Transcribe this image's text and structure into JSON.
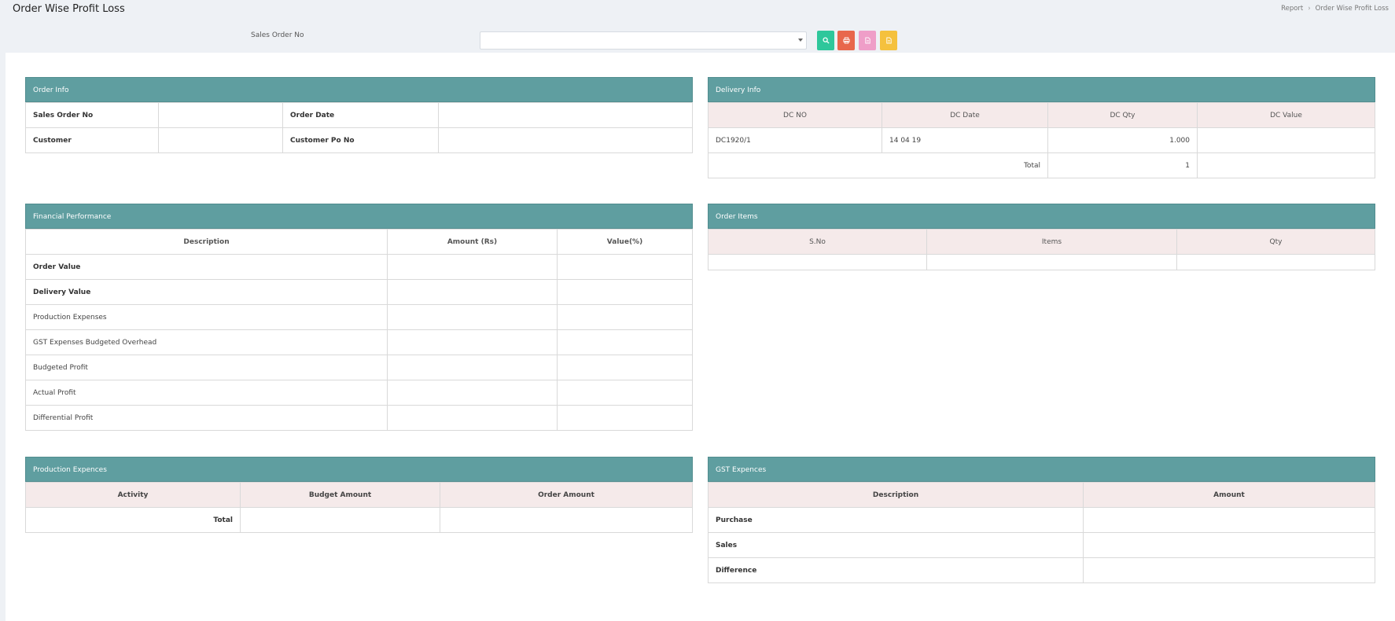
{
  "header": {
    "title": "Order Wise Profit Loss",
    "breadcrumb": [
      "Report",
      "Order Wise Profit Loss"
    ]
  },
  "filter": {
    "label": "Sales Order No",
    "selected": ""
  },
  "order_info": {
    "title": "Order Info",
    "rows": [
      [
        "Sales Order No",
        "",
        "Order Date",
        ""
      ],
      [
        "Customer",
        "",
        "Customer Po No",
        ""
      ]
    ]
  },
  "delivery_info": {
    "title": "Delivery Info",
    "columns": [
      "DC NO",
      "DC Date",
      "DC Qty",
      "DC Value"
    ],
    "rows": [
      [
        "DC1920/1",
        "14 04 19",
        "1.000",
        ""
      ]
    ],
    "total_label": "Total",
    "total_qty": "1",
    "total_value": ""
  },
  "financial": {
    "title": "Financial Performance",
    "columns": [
      "Description",
      "Amount (Rs)",
      "Value(%)"
    ],
    "rows": [
      [
        "Order Value",
        "",
        ""
      ],
      [
        "Delivery Value",
        "",
        ""
      ],
      [
        "Production Expenses",
        "",
        ""
      ],
      [
        "GST Expenses Budgeted Overhead",
        "",
        ""
      ],
      [
        "Budgeted Profit",
        "",
        ""
      ],
      [
        "Actual Profit",
        "",
        ""
      ],
      [
        "Differential Profit",
        "",
        ""
      ]
    ]
  },
  "order_items": {
    "title": "Order Items",
    "columns": [
      "S.No",
      "Items",
      "Qty"
    ]
  },
  "production": {
    "title": "Production Expences",
    "columns": [
      "Activity",
      "Budget Amount",
      "Order Amount"
    ],
    "total_label": "Total"
  },
  "gst": {
    "title": "GST Expences",
    "columns": [
      "Description",
      "Amount"
    ],
    "rows": [
      [
        "Purchase",
        ""
      ],
      [
        "Sales",
        ""
      ],
      [
        "Difference",
        ""
      ]
    ]
  }
}
